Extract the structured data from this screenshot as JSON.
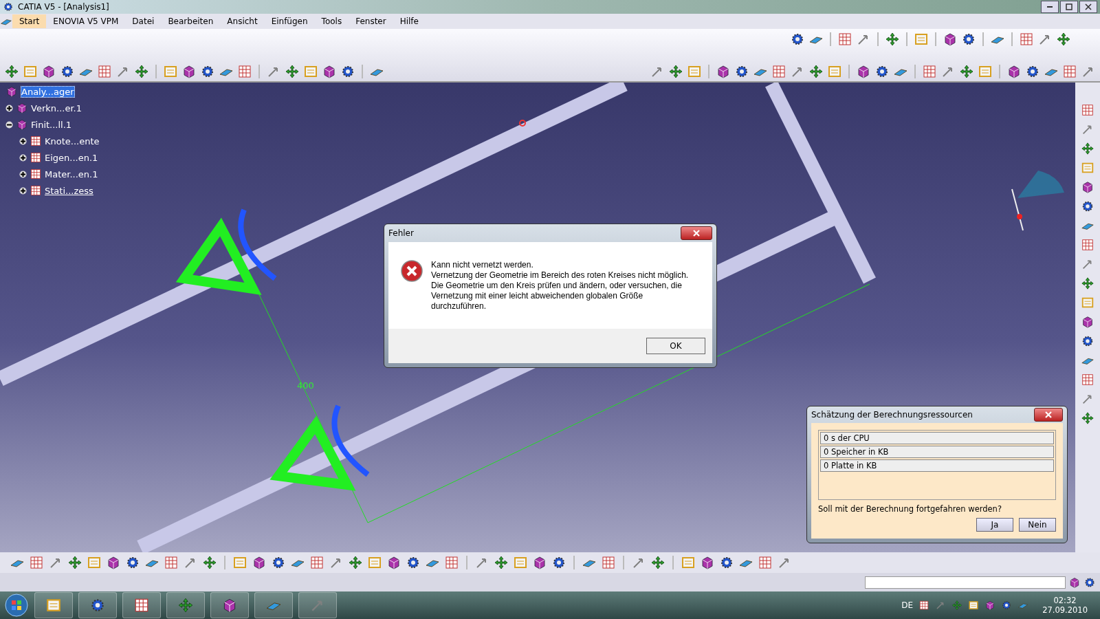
{
  "window": {
    "title": "CATIA V5 - [Analysis1]"
  },
  "menu": [
    {
      "label": "Start",
      "selected": true
    },
    {
      "label": "ENOVIA V5 VPM",
      "selected": false
    },
    {
      "label": "Datei",
      "selected": false
    },
    {
      "label": "Bearbeiten",
      "selected": false
    },
    {
      "label": "Ansicht",
      "selected": false
    },
    {
      "label": "Einfügen",
      "selected": false
    },
    {
      "label": "Tools",
      "selected": false
    },
    {
      "label": "Fenster",
      "selected": false
    },
    {
      "label": "Hilfe",
      "selected": false
    }
  ],
  "tree": {
    "root": {
      "label": "Analy...ager",
      "selected": true
    },
    "items": [
      {
        "label": "Verkn...er.1",
        "expanded": false,
        "active": false
      },
      {
        "label": "Finit...ll.1",
        "expanded": true,
        "active": false,
        "children": [
          {
            "label": "Knote...ente",
            "expanded": false,
            "active": false
          },
          {
            "label": "Eigen...en.1",
            "expanded": false,
            "active": false
          },
          {
            "label": "Mater...en.1",
            "expanded": false,
            "active": false
          },
          {
            "label": "Stati...zess",
            "expanded": false,
            "active": true
          }
        ]
      }
    ]
  },
  "viewport": {
    "dimension_label": "400"
  },
  "error_dialog": {
    "title": "Fehler",
    "message": [
      "Kann nicht vernetzt werden.",
      "Vernetzung der Geometrie im Bereich des roten Kreises nicht möglich.",
      "Die Geometrie um den Kreis prüfen und ändern, oder versuchen, die",
      "Vernetzung mit einer leicht abweichenden globalen Größe",
      "durchzuführen."
    ],
    "button": "OK"
  },
  "resource_dialog": {
    "title": "Schätzung der Berechnungsressourcen",
    "rows": [
      "0 s der CPU",
      "0 Speicher in KB",
      "0 Platte in KB"
    ],
    "question": "Soll mit der Berechnung fortgefahren werden?",
    "buttons": [
      "Ja",
      "Nein"
    ]
  },
  "taskbar": {
    "language": "DE",
    "time": "02:32",
    "date": "27.09.2010"
  }
}
